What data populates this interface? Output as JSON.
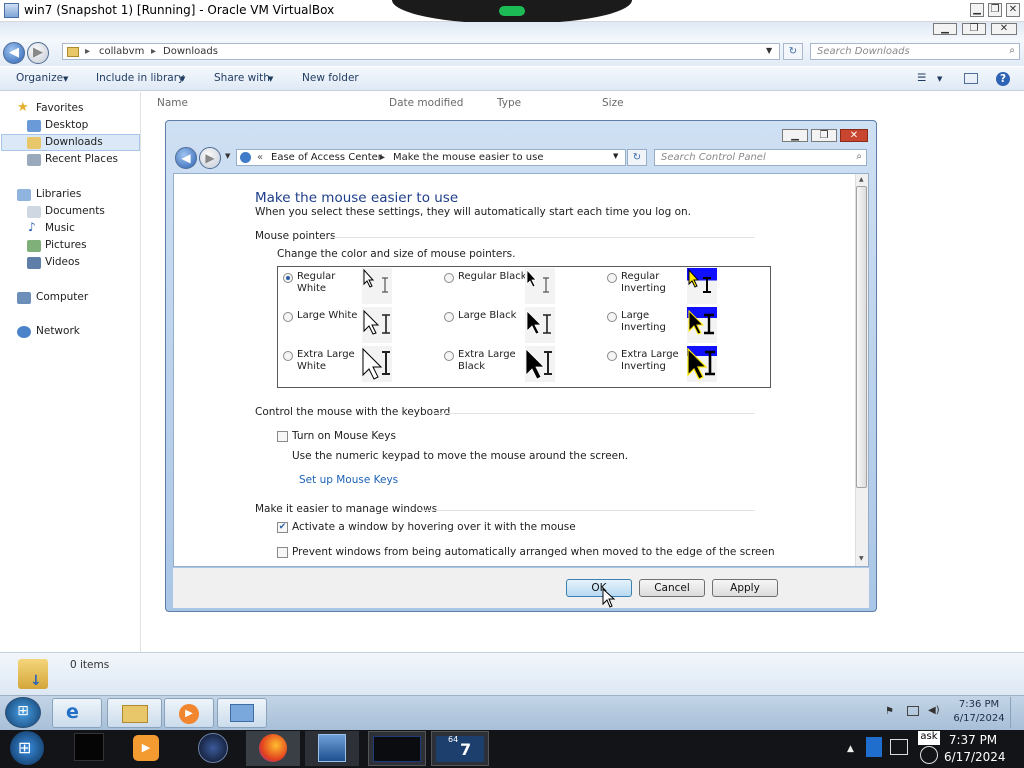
{
  "host_window": {
    "title": "win7 (Snapshot 1) [Running] - Oracle VM VirtualBox"
  },
  "explorer": {
    "breadcrumb": [
      "collabvm",
      "Downloads"
    ],
    "search_placeholder": "Search Downloads",
    "toolbar": {
      "organize": "Organize",
      "include_library": "Include in library",
      "share_with": "Share with",
      "new_folder": "New folder"
    },
    "nav": {
      "favorites": "Favorites",
      "desktop": "Desktop",
      "downloads": "Downloads",
      "recent_places": "Recent Places",
      "libraries": "Libraries",
      "documents": "Documents",
      "music": "Music",
      "pictures": "Pictures",
      "videos": "Videos",
      "computer": "Computer",
      "network": "Network"
    },
    "columns": {
      "name": "Name",
      "date_modified": "Date modified",
      "type": "Type",
      "size": "Size"
    },
    "details": {
      "items": "0 items"
    }
  },
  "dialog": {
    "breadcrumb_1": "Ease of Access Center",
    "breadcrumb_2": "Make the mouse easier to use",
    "search_placeholder": "Search Control Panel",
    "heading": "Make the mouse easier to use",
    "subheading": "When you select these settings, they will automatically start each time you log on.",
    "pointers_section": "Mouse pointers",
    "pointers_desc": "Change the color and size of mouse pointers.",
    "pointers": {
      "regular_white": "Regular White",
      "regular_black": "Regular Black",
      "regular_inverting": "Regular Inverting",
      "large_white": "Large White",
      "large_black": "Large Black",
      "large_inverting": "Large Inverting",
      "xl_white": "Extra Large White",
      "xl_black": "Extra Large Black",
      "xl_inverting": "Extra Large Inverting"
    },
    "selected_pointer": "Regular White",
    "keyboard_section": "Control the mouse with the keyboard",
    "mouse_keys_label": "Turn on Mouse Keys",
    "mouse_keys_checked": false,
    "mouse_keys_desc": "Use the numeric keypad to move the mouse around the screen.",
    "setup_link": "Set up Mouse Keys",
    "windows_section": "Make it easier to manage windows",
    "hover_label": "Activate a window by hovering over it with the mouse",
    "hover_checked": true,
    "prevent_label": "Prevent windows from being automatically arranged when moved to the edge of the screen",
    "prevent_checked": false,
    "buttons": {
      "ok": "OK",
      "cancel": "Cancel",
      "apply": "Apply"
    }
  },
  "vm_taskbar": {
    "clock_time": "7:36 PM",
    "clock_date": "6/17/2024"
  },
  "host_taskbar": {
    "clock_time": "7:37 PM",
    "clock_date": "6/17/2024",
    "tray_label": "ask",
    "tile_label": "64"
  }
}
